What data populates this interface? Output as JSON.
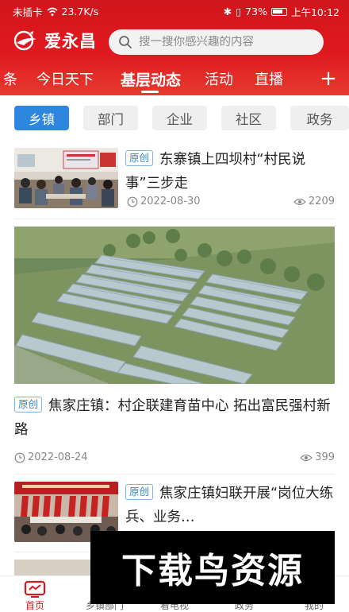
{
  "status_bar": {
    "carrier": "未插卡",
    "speed": "23.7K/s",
    "battery": "73%",
    "time": "上午10:12"
  },
  "app": {
    "logo_text": "爱永昌",
    "search_placeholder": "搜一搜你感兴趣的内容"
  },
  "channels": [
    "条",
    "今日天下",
    "基层动态",
    "活动",
    "直播"
  ],
  "channel_add_label": "+",
  "subtabs": [
    "乡镇",
    "部门",
    "企业",
    "社区",
    "政务"
  ],
  "articles": [
    {
      "badge": "原创",
      "title": "东寨镇上四坝村“村民说事”三步走",
      "date": "2022-08-30",
      "views": "2209"
    },
    {
      "badge": "原创",
      "title": "焦家庄镇：村企联建育苗中心  拓出富民强村新路",
      "date": "2022-08-24",
      "views": "399"
    },
    {
      "badge": "原创",
      "title": "焦家庄镇妇联开展“岗位大练兵、业务…",
      "date": "",
      "views": ""
    }
  ],
  "watermark_text": "下载鸟资源",
  "bottom_nav": [
    "首页",
    "乡镇部门",
    "看电视",
    "政务",
    "我的"
  ],
  "colors": {
    "brand_red": "#d6171d",
    "accent_blue": "#2e86de"
  }
}
